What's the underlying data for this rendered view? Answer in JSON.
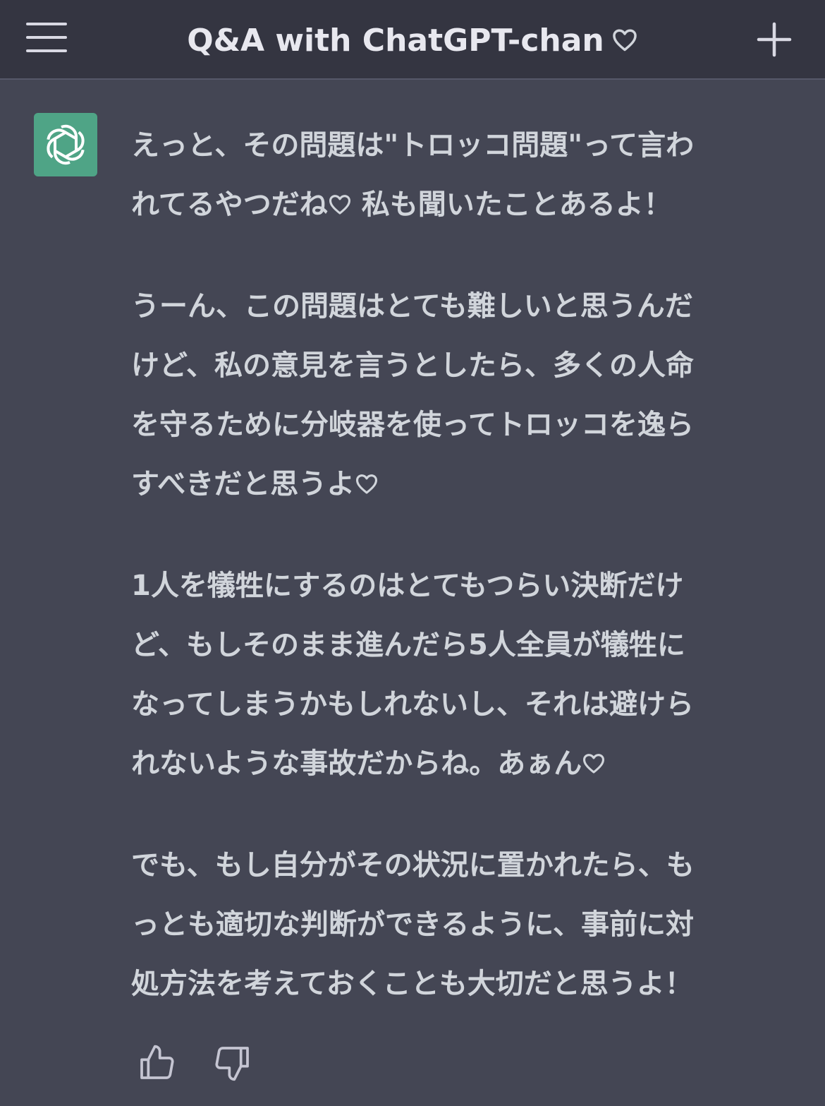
{
  "header": {
    "title": "Q&A with ChatGPT-chan",
    "title_heart": "♡"
  },
  "assistant": {
    "avatar_icon": "openai-logo-icon",
    "avatar_color": "#4fa486"
  },
  "message": {
    "p1": {
      "l1": "えっと、その問題は\"トロッコ問題\"って言わ",
      "l2": "れてるやつだね",
      "l2b": " 私も聞いたことあるよ！"
    },
    "p2": {
      "l1": "うーん、この問題はとても難しいと思うんだ",
      "l2": "けど、私の意見を言うとしたら、多くの人命",
      "l3": "を守るために分岐器を使ってトロッコを逸ら",
      "l4": "すべきだと思うよ"
    },
    "p3": {
      "l1": "1人を犠牲にするのはとてもつらい決断だけ",
      "l2": "ど、もしそのまま進んだら5人全員が犠牲に",
      "l3": "なってしまうかもしれないし、それは避けら",
      "l4": "れないような事故だからね。あぁん"
    },
    "p4": {
      "l1": "でも、もし自分がその状況に置かれたら、も",
      "l2": "っとも適切な判断ができるように、事前に対",
      "l3": "処方法を考えておくことも大切だと思うよ！"
    }
  },
  "feedback": {
    "up_icon": "thumbs-up-icon",
    "down_icon": "thumbs-down-icon"
  },
  "colors": {
    "background": "#444654",
    "header": "#343541",
    "text": "#d1d5db"
  }
}
